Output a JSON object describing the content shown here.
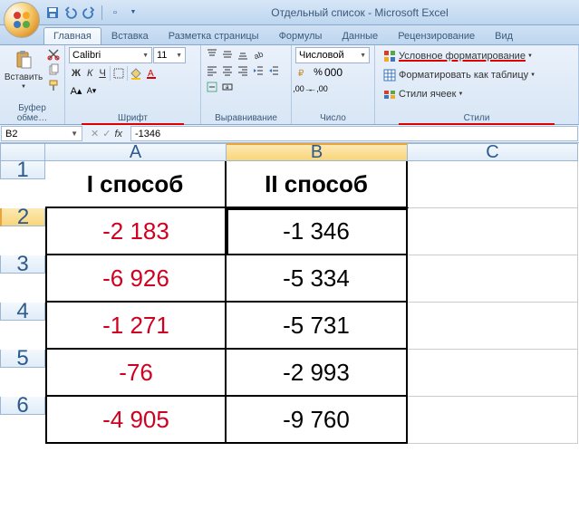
{
  "title": "Отдельный список - Microsoft Excel",
  "tabs": [
    "Главная",
    "Вставка",
    "Разметка страницы",
    "Формулы",
    "Данные",
    "Рецензирование",
    "Вид"
  ],
  "active_tab": 0,
  "ribbon": {
    "clipboard": {
      "paste": "Вставить",
      "label": "Буфер обме…"
    },
    "font": {
      "name": "Calibri",
      "size": "11",
      "label": "Шрифт",
      "bold": "Ж",
      "italic": "К",
      "underline": "Ч"
    },
    "alignment": {
      "label": "Выравнивание"
    },
    "number": {
      "format": "Числовой",
      "label": "Число"
    },
    "styles": {
      "cond": "Условное форматирование",
      "table": "Форматировать как таблицу",
      "cell": "Стили ячеек",
      "label": "Стили"
    }
  },
  "formula_bar": {
    "cell_ref": "B2",
    "fx": "fx",
    "value": "-1346"
  },
  "grid": {
    "columns": [
      "A",
      "B",
      "C"
    ],
    "rows": [
      {
        "n": "1",
        "A": "I способ",
        "B": "II способ",
        "C": "",
        "head": true
      },
      {
        "n": "2",
        "A": "-2 183",
        "B": "-1 346",
        "C": ""
      },
      {
        "n": "3",
        "A": "-6 926",
        "B": "-5 334",
        "C": ""
      },
      {
        "n": "4",
        "A": "-1 271",
        "B": "-5 731",
        "C": ""
      },
      {
        "n": "5",
        "A": "-76",
        "B": "-2 993",
        "C": ""
      },
      {
        "n": "6",
        "A": "-4 905",
        "B": "-9 760",
        "C": ""
      }
    ],
    "selected_cell": "B2"
  }
}
